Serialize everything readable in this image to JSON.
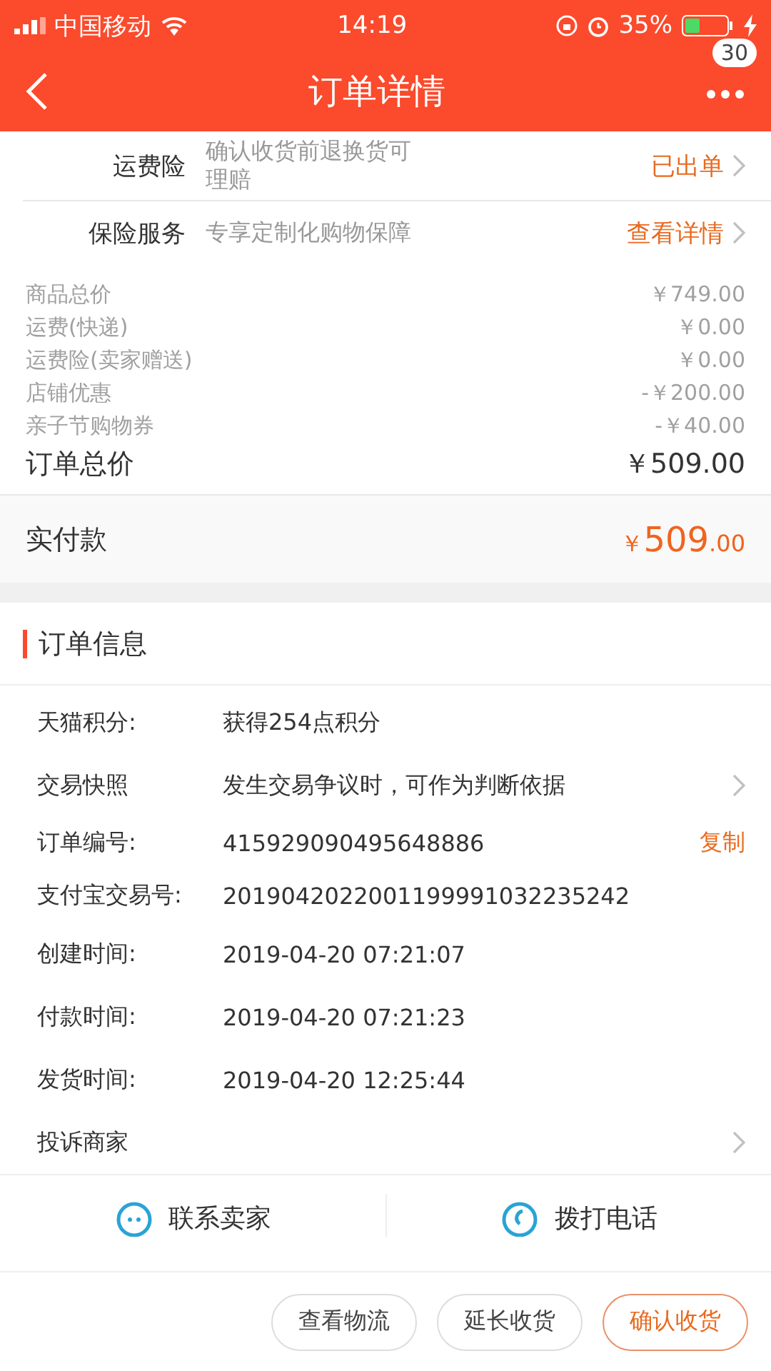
{
  "status_bar": {
    "carrier": "中国移动",
    "time": "14:19",
    "battery": "35%"
  },
  "nav": {
    "title": "订单详情",
    "badge": "30"
  },
  "services": [
    {
      "label": "运费险",
      "desc": "确认收货前退换货可理赔",
      "action": "已出单"
    },
    {
      "label": "保险服务",
      "desc": "专享定制化购物保障",
      "action": "查看详情"
    }
  ],
  "prices": [
    {
      "label": "商品总价",
      "amount": "￥749.00"
    },
    {
      "label": "运费(快递)",
      "amount": "￥0.00"
    },
    {
      "label": "运费险(卖家赠送)",
      "amount": "￥0.00"
    },
    {
      "label": "店铺优惠",
      "amount": "-￥200.00"
    },
    {
      "label": "亲子节购物券",
      "amount": "-￥40.00"
    }
  ],
  "total": {
    "label": "订单总价",
    "amount": "￥509.00"
  },
  "paid": {
    "label": "实付款",
    "currency": "￥",
    "integer": "509",
    "decimal": ".00"
  },
  "order_info": {
    "title": "订单信息",
    "rows": [
      {
        "label": "天猫积分:",
        "value": "获得254点积分",
        "kind": "plain"
      },
      {
        "label": "交易快照",
        "value": "发生交易争议时，可作为判断依据",
        "kind": "chevron"
      },
      {
        "label": "订单编号:",
        "value": "415929090495648886",
        "kind": "action",
        "action": "复制"
      },
      {
        "label": "支付宝交易号:",
        "value": "2019042022001199991032235242",
        "kind": "plain"
      },
      {
        "label": "创建时间:",
        "value": "2019-04-20 07:21:07",
        "kind": "plain"
      },
      {
        "label": "付款时间:",
        "value": "2019-04-20 07:21:23",
        "kind": "plain"
      },
      {
        "label": "发货时间:",
        "value": "2019-04-20 12:25:44",
        "kind": "plain"
      },
      {
        "label": "投诉商家",
        "kind": "chevron"
      }
    ]
  },
  "contact": [
    {
      "label": "联系卖家",
      "kind": "chat"
    },
    {
      "label": "拨打电话",
      "kind": "phone"
    }
  ],
  "buttons": [
    {
      "label": "查看物流",
      "primary": false
    },
    {
      "label": "延长收货",
      "primary": false
    },
    {
      "label": "确认收货",
      "primary": true
    }
  ]
}
